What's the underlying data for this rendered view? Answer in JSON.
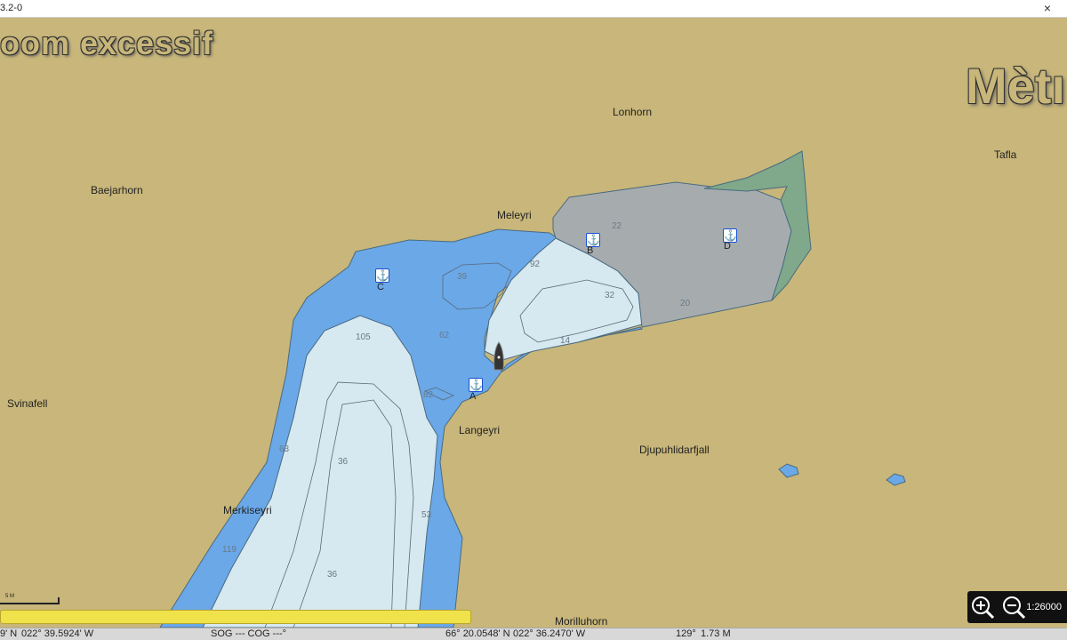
{
  "window": {
    "title": "3.2-0",
    "close_glyph": "×"
  },
  "overlay": {
    "warning": "oom excessif",
    "metric": "Mètı"
  },
  "places": [
    {
      "id": "lonhorn",
      "label": "Lonhorn"
    },
    {
      "id": "tafla",
      "label": "Tafla"
    },
    {
      "id": "baejarhorn",
      "label": "Baejarhorn"
    },
    {
      "id": "meleyri",
      "label": "Meleyri"
    },
    {
      "id": "svinafell",
      "label": "Svinafell"
    },
    {
      "id": "langeyri",
      "label": "Langeyri"
    },
    {
      "id": "djupuhlidarfjall",
      "label": "Djupuhlidarfjall"
    },
    {
      "id": "merkiseyri",
      "label": "Merkiseyri"
    },
    {
      "id": "morilluhorn",
      "label": "Morilluhorn"
    }
  ],
  "depths": [
    "22",
    "39",
    "92",
    "32",
    "105",
    "62",
    "14",
    "20",
    "82",
    "63",
    "36",
    "53",
    "119",
    "36"
  ],
  "anchorages": [
    {
      "letter": "A",
      "icon": "anchor-icon"
    },
    {
      "letter": "B",
      "icon": "anchor-icon"
    },
    {
      "letter": "C",
      "icon": "anchor-icon"
    },
    {
      "letter": "D",
      "icon": "anchor-icon"
    }
  ],
  "zoom": {
    "scale_label": "1:26000",
    "zoom_in_icon": "zoom-in-icon",
    "zoom_out_icon": "zoom-out-icon"
  },
  "scalebar": {
    "label": "5 M"
  },
  "status": {
    "lat1": "9' N",
    "lon1": "022° 39.5924' W",
    "sog_cog": "SOG --- COG ---°",
    "lat2": "66° 20.0548' N",
    "lon2": "022° 36.2470' W",
    "bearing": "129°",
    "distance": "1.73 M"
  },
  "colors": {
    "land": "#c8b67a",
    "deep_water": "#6aa8e8",
    "shallow": "#d6e8f0",
    "dry": "#a6acae",
    "green": "#7fa98a"
  }
}
